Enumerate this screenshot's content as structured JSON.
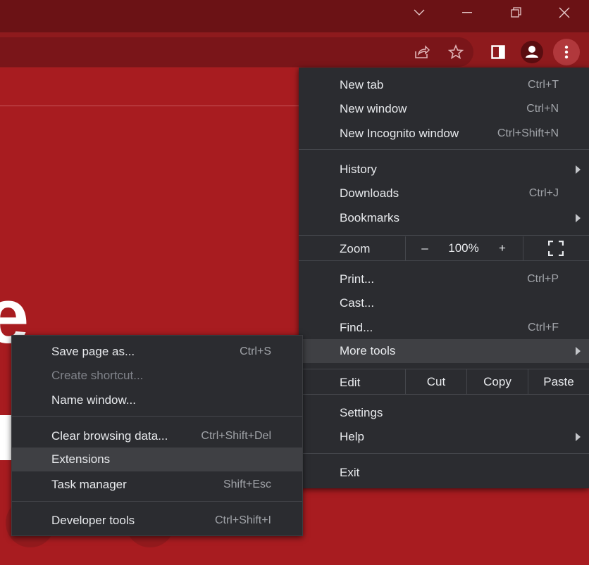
{
  "window_controls": {
    "tab_search": "tab-search-chevron",
    "minimize": "minimize",
    "restore": "restore",
    "close": "close"
  },
  "toolbar": {
    "share_icon": "share-icon",
    "bookmark_icon": "star-icon",
    "side_panel_icon": "side-panel-icon",
    "profile_icon": "profile-icon",
    "menu_icon": "kebab-menu-icon"
  },
  "page": {
    "partial_heading": "e"
  },
  "main_menu": {
    "new_tab": {
      "label": "New tab",
      "shortcut": "Ctrl+T"
    },
    "new_window": {
      "label": "New window",
      "shortcut": "Ctrl+N"
    },
    "new_incognito": {
      "label": "New Incognito window",
      "shortcut": "Ctrl+Shift+N"
    },
    "history": {
      "label": "History"
    },
    "downloads": {
      "label": "Downloads",
      "shortcut": "Ctrl+J"
    },
    "bookmarks": {
      "label": "Bookmarks"
    },
    "zoom": {
      "label": "Zoom",
      "minus": "–",
      "value": "100%",
      "plus": "+"
    },
    "print": {
      "label": "Print...",
      "shortcut": "Ctrl+P"
    },
    "cast": {
      "label": "Cast..."
    },
    "find": {
      "label": "Find...",
      "shortcut": "Ctrl+F"
    },
    "more_tools": {
      "label": "More tools"
    },
    "edit": {
      "label": "Edit",
      "cut": "Cut",
      "copy": "Copy",
      "paste": "Paste"
    },
    "settings": {
      "label": "Settings"
    },
    "help": {
      "label": "Help"
    },
    "exit": {
      "label": "Exit"
    }
  },
  "sub_menu": {
    "save_page": {
      "label": "Save page as...",
      "shortcut": "Ctrl+S"
    },
    "create_shortcut": {
      "label": "Create shortcut..."
    },
    "name_window": {
      "label": "Name window..."
    },
    "clear_data": {
      "label": "Clear browsing data...",
      "shortcut": "Ctrl+Shift+Del"
    },
    "extensions": {
      "label": "Extensions"
    },
    "task_manager": {
      "label": "Task manager",
      "shortcut": "Shift+Esc"
    },
    "dev_tools": {
      "label": "Developer tools",
      "shortcut": "Ctrl+Shift+I"
    }
  },
  "colors": {
    "page_bg": "#a81c20",
    "menu_bg": "#2b2c30",
    "highlight": "#3f4044"
  }
}
